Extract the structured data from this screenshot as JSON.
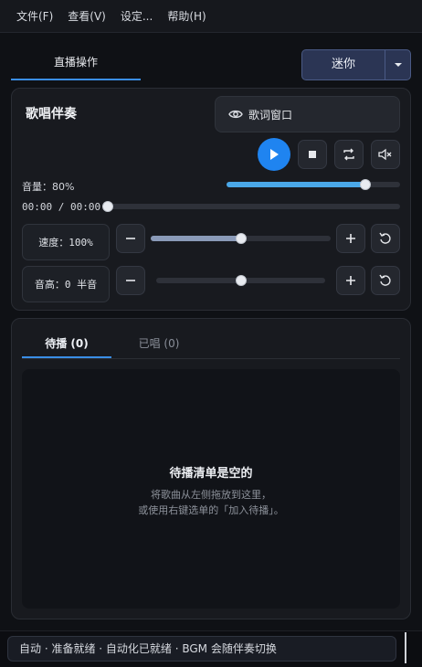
{
  "menu": [
    "文件(F)",
    "查看(V)",
    "设定...",
    "帮助(H)"
  ],
  "top_tab": "直播操作",
  "mini_button": "迷你",
  "accompaniment": {
    "title": "歌唱伴奏",
    "lyrics_window_label": "歌词窗口",
    "volume_label": "音量：80%",
    "volume_value": 0.8,
    "time_readout": "00:00 / 00:00",
    "progress_value": 0.0,
    "speed_label": "速度：100%",
    "speed_value": 0.5,
    "pitch_label": "音高：0 半音",
    "pitch_value": 0.5
  },
  "queue": {
    "tabs": [
      "待播 (0)",
      "已唱 (0)"
    ],
    "empty_title": "待播清单是空的",
    "empty_line1": "将歌曲从左侧拖放到这里，",
    "empty_line2": "或使用右键选单的「加入待播」。"
  },
  "status": "自动 · 准备就绪 · 自动化已就绪 · BGM 会随伴奏切换",
  "colors": {
    "accent": "#1f84f0",
    "volume_fill": "#4aa8e8",
    "slider_fill": "#8a9ab8"
  }
}
